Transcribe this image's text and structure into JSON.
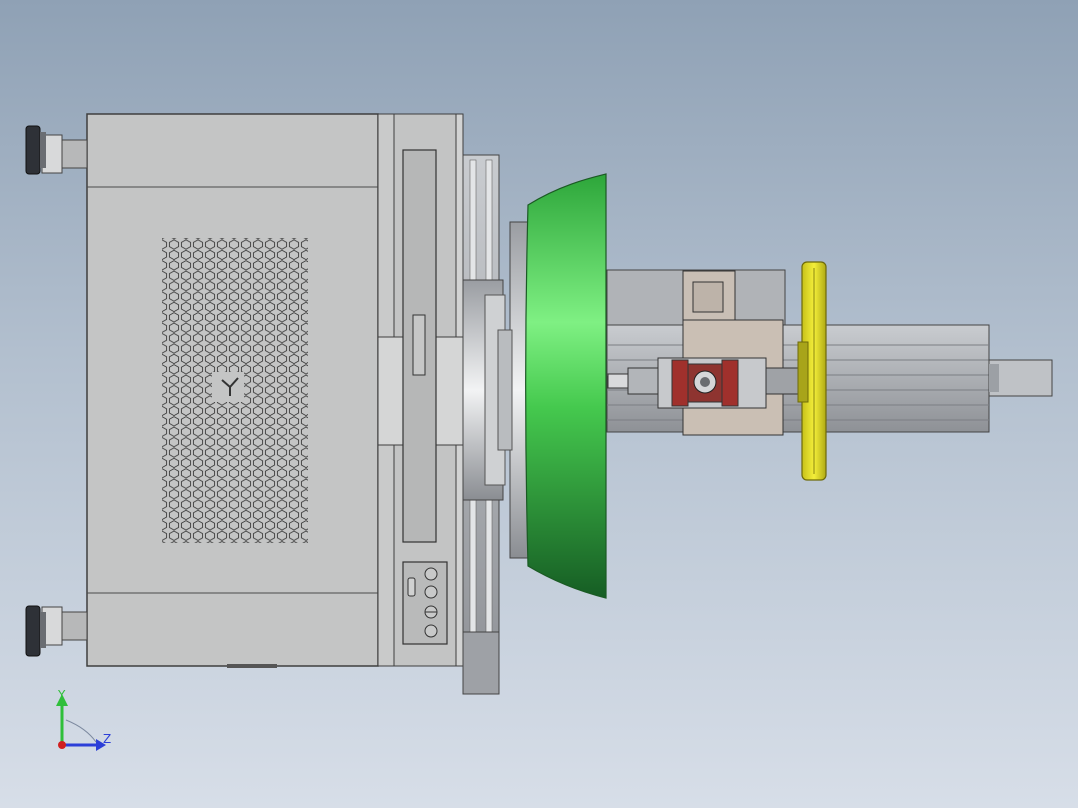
{
  "viewport": {
    "background_top": "#8fa1b5",
    "background_bottom": "#d7dee8"
  },
  "colors": {
    "cabinet": "#c4c5c5",
    "cabinet_edge": "#4a4a4a",
    "guard_green": "#3fd04a",
    "guard_green_light": "#8af28e",
    "guard_green_dark": "#1c6a2a",
    "yellow_disc": "#e6e021",
    "rail_gray": "#a9acb0",
    "motor_red": "#a0302c"
  },
  "triad": {
    "y_label": "Y",
    "z_label": "Z",
    "y_color": "#2fbf3a",
    "z_color": "#2c3fd8",
    "x_color": "#d02020"
  },
  "control_panel": {
    "buttons": 4
  }
}
